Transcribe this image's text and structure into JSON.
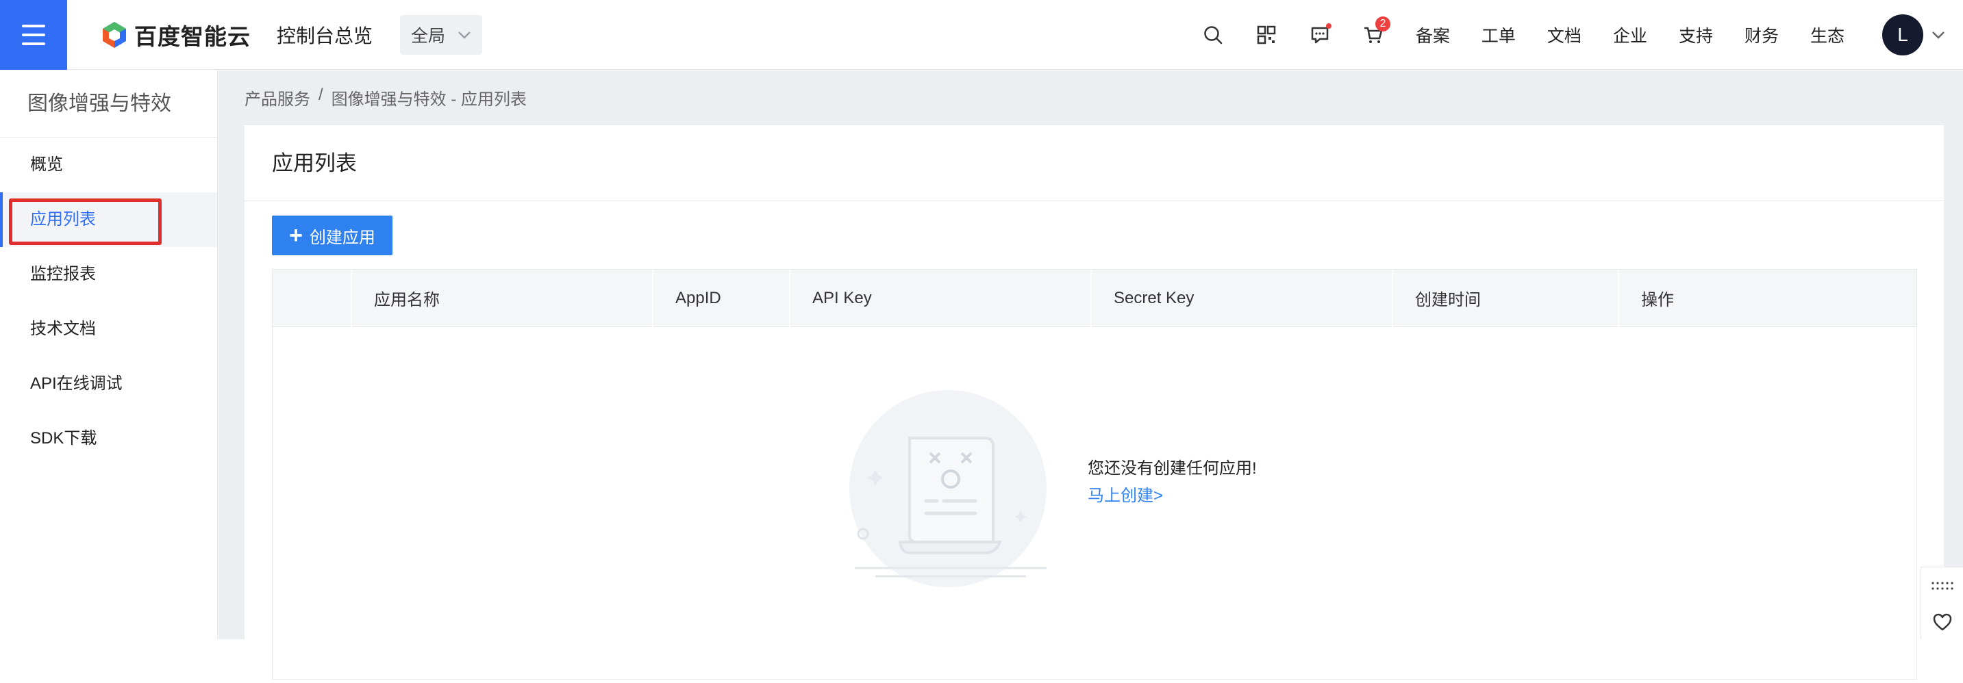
{
  "header": {
    "brand": "百度智能云",
    "console_title": "控制台总览",
    "region_label": "全局",
    "cart_badge": "2",
    "links": [
      "备案",
      "工单",
      "文档",
      "企业",
      "支持",
      "财务",
      "生态"
    ],
    "avatar_initial": "L"
  },
  "sidebar": {
    "title": "图像增强与特效",
    "items": [
      {
        "label": "概览"
      },
      {
        "label": "应用列表"
      },
      {
        "label": "监控报表"
      },
      {
        "label": "技术文档"
      },
      {
        "label": "API在线调试"
      },
      {
        "label": "SDK下载"
      }
    ]
  },
  "breadcrumb": {
    "root": "产品服务",
    "sep": "/",
    "current": "图像增强与特效 - 应用列表"
  },
  "page": {
    "title": "应用列表",
    "create_button": "创建应用",
    "table_headers": [
      "应用名称",
      "AppID",
      "API Key",
      "Secret Key",
      "创建时间",
      "操作"
    ],
    "empty_text": "您还没有创建任何应用!",
    "empty_link": "马上创建>"
  },
  "colors": {
    "accent": "#2f6ef5",
    "button": "#2f81ef",
    "highlight": "#e02d2d",
    "badge": "#ee3f3f"
  }
}
